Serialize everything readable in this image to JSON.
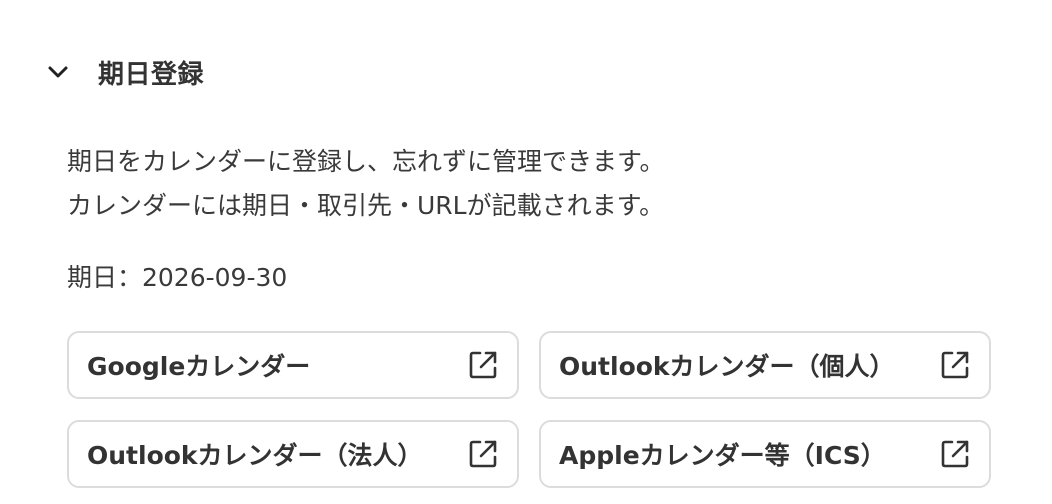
{
  "section": {
    "title": "期日登録",
    "toggle_icon": "chevron-down-icon"
  },
  "description": {
    "line1": "期日をカレンダーに登録し、忘れずに管理できます。",
    "line2": "カレンダーには期日・取引先・URLが記載されます。"
  },
  "due_date": {
    "text": "期日：2026-09-30"
  },
  "calendar_buttons": [
    {
      "label": "Googleカレンダー",
      "icon": "external-link-icon"
    },
    {
      "label": "Outlookカレンダー（個人）",
      "icon": "external-link-icon"
    },
    {
      "label": "Outlookカレンダー（法人）",
      "icon": "external-link-icon"
    },
    {
      "label": "Appleカレンダー等（ICS）",
      "icon": "external-link-icon"
    }
  ],
  "colors": {
    "text": "#333333",
    "border": "#dcdcdc",
    "background": "#ffffff"
  }
}
